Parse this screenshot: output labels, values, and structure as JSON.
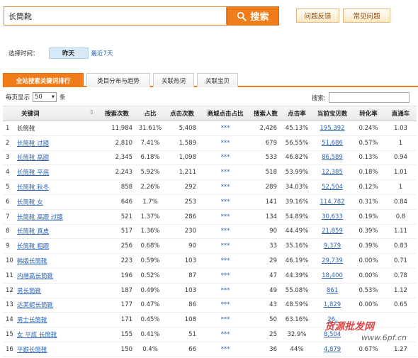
{
  "search": {
    "value": "长筒靴",
    "button_label": "搜索"
  },
  "top_links": {
    "feedback": "问题反馈",
    "faq": "常见问题"
  },
  "time": {
    "label": "选择时间：",
    "options": [
      "昨天",
      "最近7天"
    ]
  },
  "tabs": [
    "全站搜索关键词排行",
    "类目分布与趋势",
    "关联热词",
    "关联宝贝"
  ],
  "perpage": {
    "prefix": "每页显示",
    "value": "50",
    "suffix": "条"
  },
  "filter": {
    "label": "搜索:"
  },
  "columns": [
    "关键词",
    "搜索次数",
    "占比",
    "点击次数",
    "商城点击占比",
    "搜索人数",
    "点击率",
    "当前宝贝数",
    "转化率",
    "直通车"
  ],
  "rows": [
    {
      "n": "1",
      "kw": "长筒靴",
      "search": "11,984",
      "ratio": "31.61%",
      "clicks": "5,408",
      "mall": "***",
      "people": "2,426",
      "ctr": "45.13%",
      "items": "195,392",
      "conv": "0.24%",
      "ztc": "1.03"
    },
    {
      "n": "2",
      "kw": "长筒靴 过膝",
      "search": "2,810",
      "ratio": "7.41%",
      "clicks": "1,589",
      "mall": "***",
      "people": "679",
      "ctr": "56.55%",
      "items": "51,686",
      "conv": "0.57%",
      "ztc": "1"
    },
    {
      "n": "3",
      "kw": "长筒靴 高跟",
      "search": "2,345",
      "ratio": "6.18%",
      "clicks": "1,098",
      "mall": "***",
      "people": "533",
      "ctr": "46.82%",
      "items": "86,589",
      "conv": "0.13%",
      "ztc": "0.94"
    },
    {
      "n": "4",
      "kw": "长筒靴 平底",
      "search": "2,243",
      "ratio": "5.92%",
      "clicks": "1,211",
      "mall": "***",
      "people": "518",
      "ctr": "53.99%",
      "items": "12,385",
      "conv": "0.18%",
      "ztc": "1.01"
    },
    {
      "n": "5",
      "kw": "长筒靴 秋冬",
      "search": "858",
      "ratio": "2.26%",
      "clicks": "292",
      "mall": "***",
      "people": "289",
      "ctr": "34.03%",
      "items": "52,504",
      "conv": "0.12%",
      "ztc": "1"
    },
    {
      "n": "6",
      "kw": "长筒靴 女",
      "search": "646",
      "ratio": "1.7%",
      "clicks": "253",
      "mall": "***",
      "people": "141",
      "ctr": "39.16%",
      "items": "114,782",
      "conv": "0.31%",
      "ztc": "0.84"
    },
    {
      "n": "7",
      "kw": "长筒靴 高跟 过膝",
      "search": "521",
      "ratio": "1.37%",
      "clicks": "286",
      "mall": "***",
      "people": "134",
      "ctr": "54.89%",
      "items": "30,633",
      "conv": "0.19%",
      "ztc": "0.8"
    },
    {
      "n": "8",
      "kw": "长筒靴 真皮",
      "search": "517",
      "ratio": "1.36%",
      "clicks": "230",
      "mall": "***",
      "people": "90",
      "ctr": "44.49%",
      "items": "21,859",
      "conv": "0.39%",
      "ztc": "1.11"
    },
    {
      "n": "9",
      "kw": "长筒靴 粗跟",
      "search": "256",
      "ratio": "0.68%",
      "clicks": "90",
      "mall": "***",
      "people": "33",
      "ctr": "35.16%",
      "items": "9,379",
      "conv": "0.39%",
      "ztc": "0.83"
    },
    {
      "n": "10",
      "kw": "韩版长筒靴",
      "search": "223",
      "ratio": "0.59%",
      "clicks": "103",
      "mall": "***",
      "people": "29",
      "ctr": "46.19%",
      "items": "29,739",
      "conv": "0.00%",
      "ztc": "0.71"
    },
    {
      "n": "11",
      "kw": "内增高长筒靴",
      "search": "196",
      "ratio": "0.52%",
      "clicks": "87",
      "mall": "***",
      "people": "47",
      "ctr": "44.39%",
      "items": "18,400",
      "conv": "0.00%",
      "ztc": "0.78"
    },
    {
      "n": "12",
      "kw": "男长筒靴",
      "search": "187",
      "ratio": "0.49%",
      "clicks": "103",
      "mall": "***",
      "people": "49",
      "ctr": "55.08%",
      "items": "861",
      "conv": "0.53%",
      "ztc": "1.12"
    },
    {
      "n": "13",
      "kw": "达芙妮长筒靴",
      "search": "177",
      "ratio": "0.47%",
      "clicks": "86",
      "mall": "***",
      "people": "43",
      "ctr": "48.59%",
      "items": "1,829",
      "conv": "0.00%",
      "ztc": "0.65"
    },
    {
      "n": "14",
      "kw": "男士长筒靴",
      "search": "171",
      "ratio": "0.45%",
      "clicks": "108",
      "mall": "***",
      "people": "50",
      "ctr": "63.16%",
      "items": "26,",
      "conv": "",
      "ztc": ""
    },
    {
      "n": "15",
      "kw": "女 平底 长筒靴",
      "search": "155",
      "ratio": "0.41%",
      "clicks": "51",
      "mall": "***",
      "people": "25",
      "ctr": "32.9%",
      "items": "8,504",
      "conv": "",
      "ztc": ""
    },
    {
      "n": "16",
      "kw": "平跟长筒靴",
      "search": "150",
      "ratio": "0.4%",
      "clicks": "66",
      "mall": "***",
      "people": "36",
      "ctr": "44%",
      "items": "4,879",
      "conv": "0.67%",
      "ztc": "1.27"
    }
  ],
  "watermark": {
    "text": "货源批发网",
    "domain": "www.6pf.cn"
  }
}
